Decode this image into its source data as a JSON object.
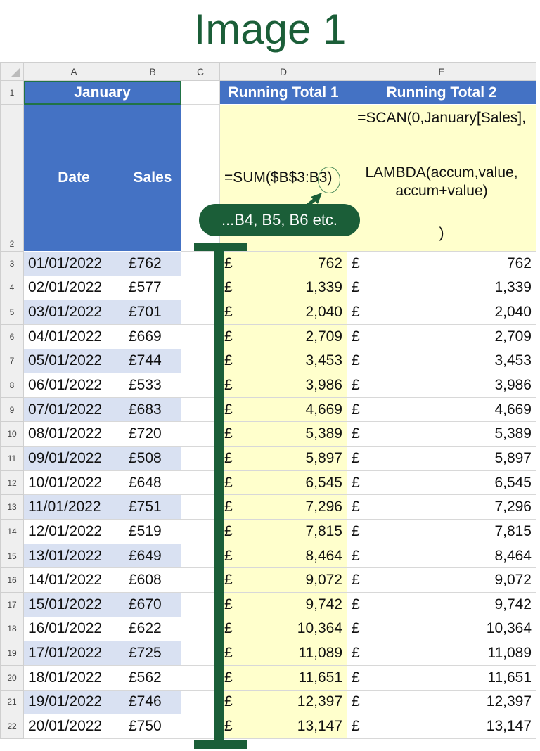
{
  "title": "Image 1",
  "columns": [
    "A",
    "B",
    "C",
    "D",
    "E"
  ],
  "header": {
    "table_name": "January",
    "date_label": "Date",
    "sales_label": "Sales",
    "rt1_label": "Running Total 1",
    "rt2_label": "Running Total 2",
    "rt1_formula": "=SUM($B$3:B3)",
    "rt2_formula_line1": "=SCAN(0,January[Sales],",
    "rt2_formula_line2": "LAMBDA(accum,value,",
    "rt2_formula_line3": "accum+value)",
    "rt2_formula_line4": ")"
  },
  "callout": "...B4, B5, B6 etc.",
  "currency": "£",
  "rows": [
    {
      "n": "3",
      "date": "01/01/2022",
      "sales": "£762",
      "rt1": "762",
      "rt2": "762"
    },
    {
      "n": "4",
      "date": "02/01/2022",
      "sales": "£577",
      "rt1": "1,339",
      "rt2": "1,339"
    },
    {
      "n": "5",
      "date": "03/01/2022",
      "sales": "£701",
      "rt1": "2,040",
      "rt2": "2,040"
    },
    {
      "n": "6",
      "date": "04/01/2022",
      "sales": "£669",
      "rt1": "2,709",
      "rt2": "2,709"
    },
    {
      "n": "7",
      "date": "05/01/2022",
      "sales": "£744",
      "rt1": "3,453",
      "rt2": "3,453"
    },
    {
      "n": "8",
      "date": "06/01/2022",
      "sales": "£533",
      "rt1": "3,986",
      "rt2": "3,986"
    },
    {
      "n": "9",
      "date": "07/01/2022",
      "sales": "£683",
      "rt1": "4,669",
      "rt2": "4,669"
    },
    {
      "n": "10",
      "date": "08/01/2022",
      "sales": "£720",
      "rt1": "5,389",
      "rt2": "5,389"
    },
    {
      "n": "11",
      "date": "09/01/2022",
      "sales": "£508",
      "rt1": "5,897",
      "rt2": "5,897"
    },
    {
      "n": "12",
      "date": "10/01/2022",
      "sales": "£648",
      "rt1": "6,545",
      "rt2": "6,545"
    },
    {
      "n": "13",
      "date": "11/01/2022",
      "sales": "£751",
      "rt1": "7,296",
      "rt2": "7,296"
    },
    {
      "n": "14",
      "date": "12/01/2022",
      "sales": "£519",
      "rt1": "7,815",
      "rt2": "7,815"
    },
    {
      "n": "15",
      "date": "13/01/2022",
      "sales": "£649",
      "rt1": "8,464",
      "rt2": "8,464"
    },
    {
      "n": "16",
      "date": "14/01/2022",
      "sales": "£608",
      "rt1": "9,072",
      "rt2": "9,072"
    },
    {
      "n": "17",
      "date": "15/01/2022",
      "sales": "£670",
      "rt1": "9,742",
      "rt2": "9,742"
    },
    {
      "n": "18",
      "date": "16/01/2022",
      "sales": "£622",
      "rt1": "10,364",
      "rt2": "10,364"
    },
    {
      "n": "19",
      "date": "17/01/2022",
      "sales": "£725",
      "rt1": "11,089",
      "rt2": "11,089"
    },
    {
      "n": "20",
      "date": "18/01/2022",
      "sales": "£562",
      "rt1": "11,651",
      "rt2": "11,651"
    },
    {
      "n": "21",
      "date": "19/01/2022",
      "sales": "£746",
      "rt1": "12,397",
      "rt2": "12,397"
    },
    {
      "n": "22",
      "date": "20/01/2022",
      "sales": "£750",
      "rt1": "13,147",
      "rt2": "13,147"
    }
  ]
}
